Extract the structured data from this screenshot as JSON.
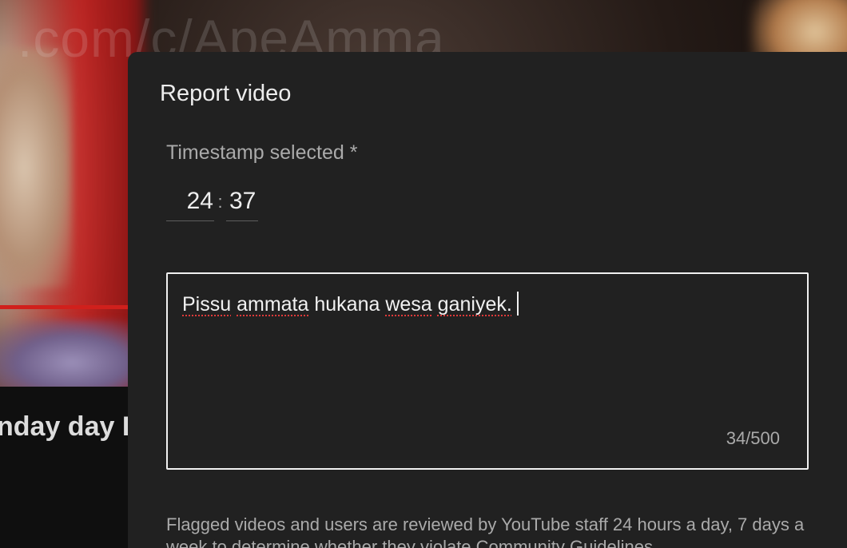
{
  "background": {
    "watermark": ".com/c/ApeAmma",
    "video_title": "nday day L"
  },
  "dialog": {
    "title": "Report video",
    "timestamp": {
      "label": "Timestamp selected *",
      "minutes": "24",
      "separator": ":",
      "seconds": "37"
    },
    "reason": {
      "word_1": "Pissu",
      "word_2": "ammata",
      "word_3": "hukana",
      "word_4": "wesa",
      "word_5": "ganiyek.",
      "char_count": "34/500"
    },
    "footer_note": "Flagged videos and users are reviewed by YouTube staff 24 hours a day, 7 days a week to determine whether they violate Community Guidelines."
  },
  "colors": {
    "dialog_bg": "#212121",
    "progress": "#d0201c",
    "spellcheck": "#e03a3a"
  }
}
